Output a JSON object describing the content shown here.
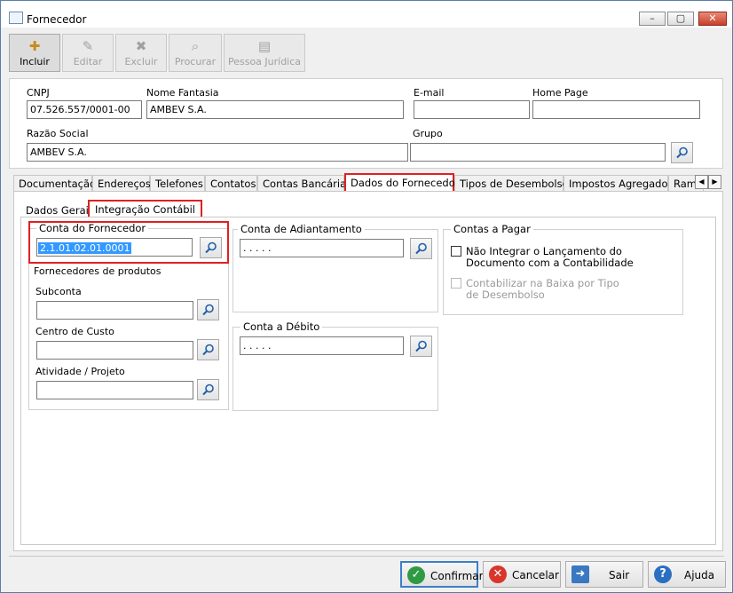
{
  "window": {
    "title": "Fornecedor",
    "minimize": "–",
    "maximize": "▢",
    "close": "✕"
  },
  "toolbar": [
    {
      "id": "incluir",
      "label": "Incluir",
      "icon": "new-doc-icon",
      "enabled": true
    },
    {
      "id": "editar",
      "label": "Editar",
      "icon": "edit-doc-icon",
      "enabled": false
    },
    {
      "id": "excluir",
      "label": "Excluir",
      "icon": "delete-doc-icon",
      "enabled": false
    },
    {
      "id": "procurar",
      "label": "Procurar",
      "icon": "search-doc-icon",
      "enabled": false
    },
    {
      "id": "pessoa",
      "label": "Pessoa Jurídica",
      "icon": "id-card-icon",
      "enabled": false
    }
  ],
  "header": {
    "cnpj_label": "CNPJ",
    "cnpj_value": "07.526.557/0001-00",
    "fantasia_label": "Nome Fantasia",
    "fantasia_value": "AMBEV S.A.",
    "email_label": "E-mail",
    "email_value": "",
    "homepage_label": "Home Page",
    "homepage_value": "",
    "razao_label": "Razão Social",
    "razao_value": "AMBEV S.A.",
    "grupo_label": "Grupo",
    "grupo_value": ""
  },
  "tabs": [
    "Documentação",
    "Endereços",
    "Telefones",
    "Contatos",
    "Contas Bancárias",
    "Dados do Fornecedor",
    "Tipos de Desembolso",
    "Impostos Agregados",
    "Ramo"
  ],
  "selected_tab": "Dados do Fornecedor",
  "subtabs": [
    "Dados Gerais",
    "Integração Contábil"
  ],
  "selected_subtab": "Integração Contábil",
  "integracao": {
    "conta_fornecedor_title": "Conta do Fornecedor",
    "conta_fornecedor_value": "2.1.01.02.01.0001",
    "fornecedores_produtos_label": "Fornecedores de produtos",
    "subconta_label": "Subconta",
    "subconta_value": "",
    "centro_custo_label": "Centro de Custo",
    "centro_custo_value": "",
    "atividade_label": "Atividade / Projeto",
    "atividade_value": "",
    "conta_adiantamento_title": "Conta de Adiantamento",
    "conta_adiantamento_value": ". . . . .",
    "conta_debito_title": "Conta a Débito",
    "conta_debito_value": ". . . . .",
    "contas_pagar_title": "Contas a Pagar",
    "nao_integrar_label": "Não Integrar o Lançamento do Documento com a Contabilidade",
    "nao_integrar_checked": false,
    "contabilizar_baixa_label": "Contabilizar na Baixa por Tipo de Desembolso",
    "contabilizar_baixa_checked": false
  },
  "buttons": {
    "confirmar": "Confirmar",
    "cancelar": "Cancelar",
    "sair": "Sair",
    "ajuda": "Ajuda"
  },
  "colors": {
    "highlight": "#e02020",
    "selection": "#3399ff",
    "confirm": "#2e9b44",
    "cancel": "#d9352a",
    "help": "#2a6fc1"
  }
}
